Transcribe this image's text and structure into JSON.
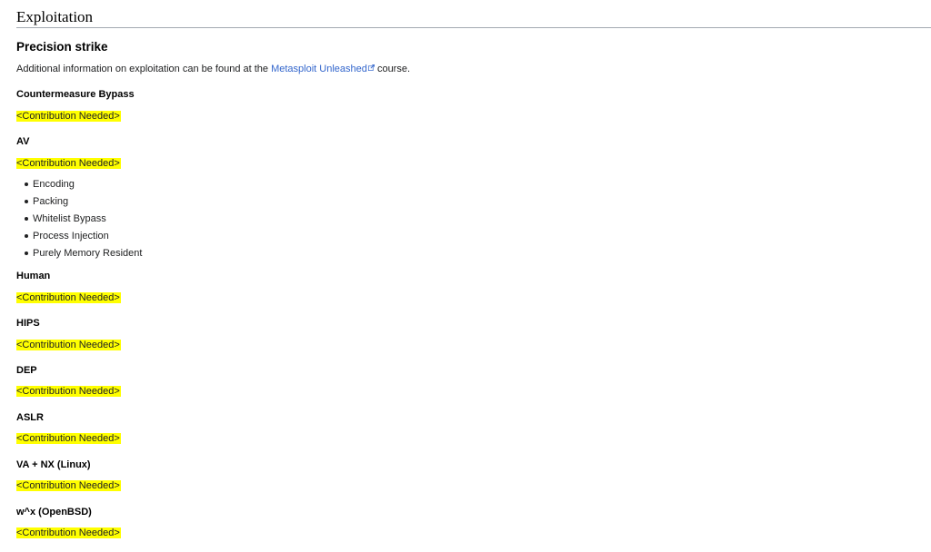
{
  "section_title": "Exploitation",
  "subsection_title": "Precision strike",
  "intro": {
    "before": "Additional information on exploitation can be found at the ",
    "link_text": "Metasploit Unleashed",
    "after": " course."
  },
  "link_icon": "external-link-icon",
  "highlight_color": "#ffff00",
  "link_color": "#3366cc",
  "headings": [
    "Countermeasure Bypass",
    "AV",
    "Human",
    "HIPS",
    "DEP",
    "ASLR",
    "VA + NX (Linux)",
    "w^x (OpenBSD)"
  ],
  "contribution_text": "<Contribution Needed>",
  "av_items": [
    "Encoding",
    "Packing",
    "Whitelist Bypass",
    "Process Injection",
    "Purely Memory Resident"
  ]
}
